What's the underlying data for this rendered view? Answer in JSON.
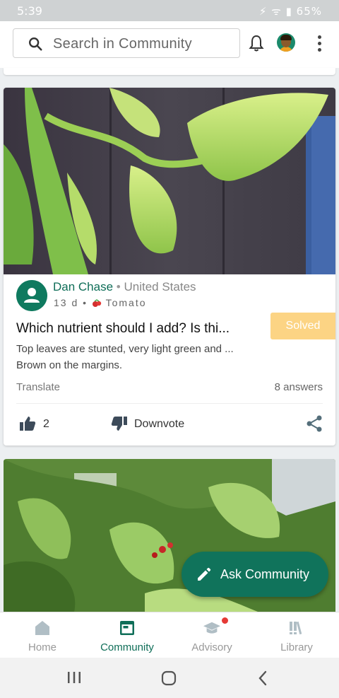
{
  "status_bar": {
    "time": "5:39",
    "icons": "⚡ ᯤ ▮",
    "battery": "65%"
  },
  "search": {
    "placeholder": "Search in Community"
  },
  "post": {
    "author": "Dan Chase",
    "separator": "•",
    "country": "United States",
    "age": "13 d",
    "crop": "Tomato",
    "status": "Solved",
    "title": "Which nutrient should I add? Is thi...",
    "body": "Top leaves are stunted, very light green and ... Brown on the margins.",
    "translate_label": "Translate",
    "answers": "8 answers",
    "upvotes": "2",
    "downvote_label": "Downvote"
  },
  "fab": {
    "label": "Ask Community"
  },
  "bottom_nav": {
    "items": [
      {
        "label": "Home",
        "icon": "home-icon"
      },
      {
        "label": "Community",
        "icon": "community-icon"
      },
      {
        "label": "Advisory",
        "icon": "graduation-cap-icon"
      },
      {
        "label": "Library",
        "icon": "library-icon"
      }
    ],
    "active": "Community"
  },
  "colors": {
    "brand": "#0f6e58",
    "fab": "#10735b",
    "solved": "#fcd484",
    "notification": "#e53935"
  }
}
